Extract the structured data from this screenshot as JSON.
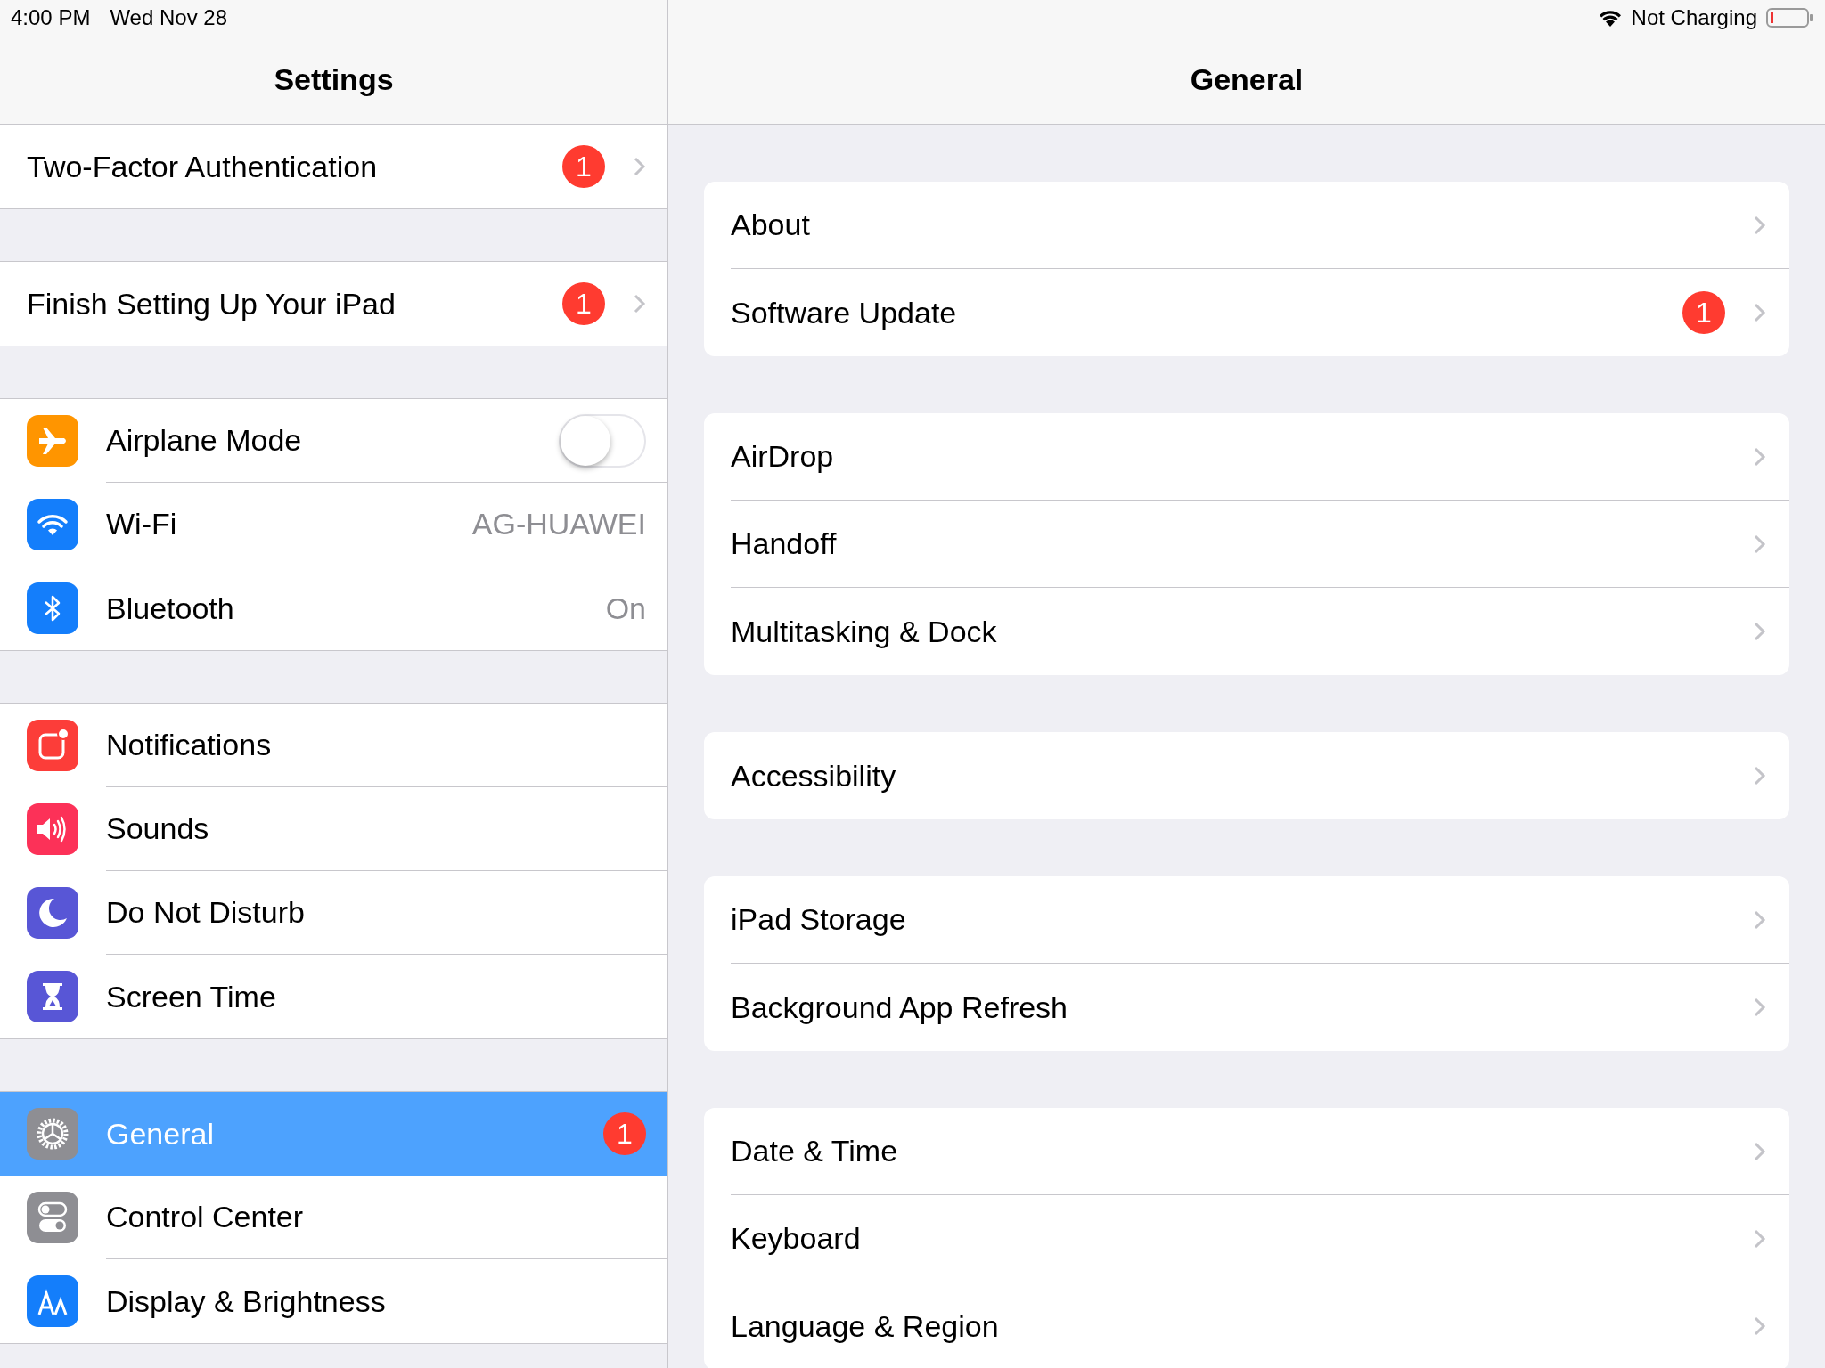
{
  "status_bar": {
    "time": "4:00 PM",
    "date": "Wed Nov 28",
    "battery_label": "Not Charging"
  },
  "sidebar": {
    "title": "Settings",
    "groups": [
      {
        "items": [
          {
            "label": "Two-Factor Authentication",
            "kind": "link",
            "badge": "1",
            "selected": false
          }
        ]
      },
      {
        "items": [
          {
            "label": "Finish Setting Up Your iPad",
            "kind": "link",
            "badge": "1",
            "selected": false
          }
        ]
      },
      {
        "items": [
          {
            "label": "Airplane Mode",
            "kind": "toggle",
            "on": false,
            "color": "#ff9500",
            "selected": false
          },
          {
            "label": "Wi-Fi",
            "kind": "value",
            "value": "AG-HUAWEI",
            "color": "#147efb",
            "selected": false
          },
          {
            "label": "Bluetooth",
            "kind": "value",
            "value": "On",
            "color": "#147efb",
            "selected": false
          }
        ]
      },
      {
        "items": [
          {
            "label": "Notifications",
            "kind": "plain",
            "color": "#fc3d39",
            "selected": false
          },
          {
            "label": "Sounds",
            "kind": "plain",
            "color": "#fc3158",
            "selected": false
          },
          {
            "label": "Do Not Disturb",
            "kind": "plain",
            "color": "#5856d6",
            "selected": false
          },
          {
            "label": "Screen Time",
            "kind": "plain",
            "color": "#5856d6",
            "selected": false
          }
        ]
      },
      {
        "items": [
          {
            "label": "General",
            "kind": "plain",
            "badge": "1",
            "color": "#8e8e93",
            "selected": true
          },
          {
            "label": "Control Center",
            "kind": "plain",
            "color": "#8e8e93",
            "selected": false
          },
          {
            "label": "Display & Brightness",
            "kind": "plain",
            "color": "#147efb",
            "selected": false
          }
        ]
      }
    ]
  },
  "detail": {
    "title": "General",
    "groups": [
      {
        "items": [
          {
            "label": "About"
          },
          {
            "label": "Software Update",
            "badge": "1"
          }
        ]
      },
      {
        "items": [
          {
            "label": "AirDrop"
          },
          {
            "label": "Handoff"
          },
          {
            "label": "Multitasking & Dock"
          }
        ]
      },
      {
        "items": [
          {
            "label": "Accessibility"
          }
        ]
      },
      {
        "items": [
          {
            "label": "iPad Storage"
          },
          {
            "label": "Background App Refresh"
          }
        ]
      },
      {
        "items": [
          {
            "label": "Date & Time"
          },
          {
            "label": "Keyboard"
          },
          {
            "label": "Language & Region"
          }
        ]
      }
    ]
  }
}
